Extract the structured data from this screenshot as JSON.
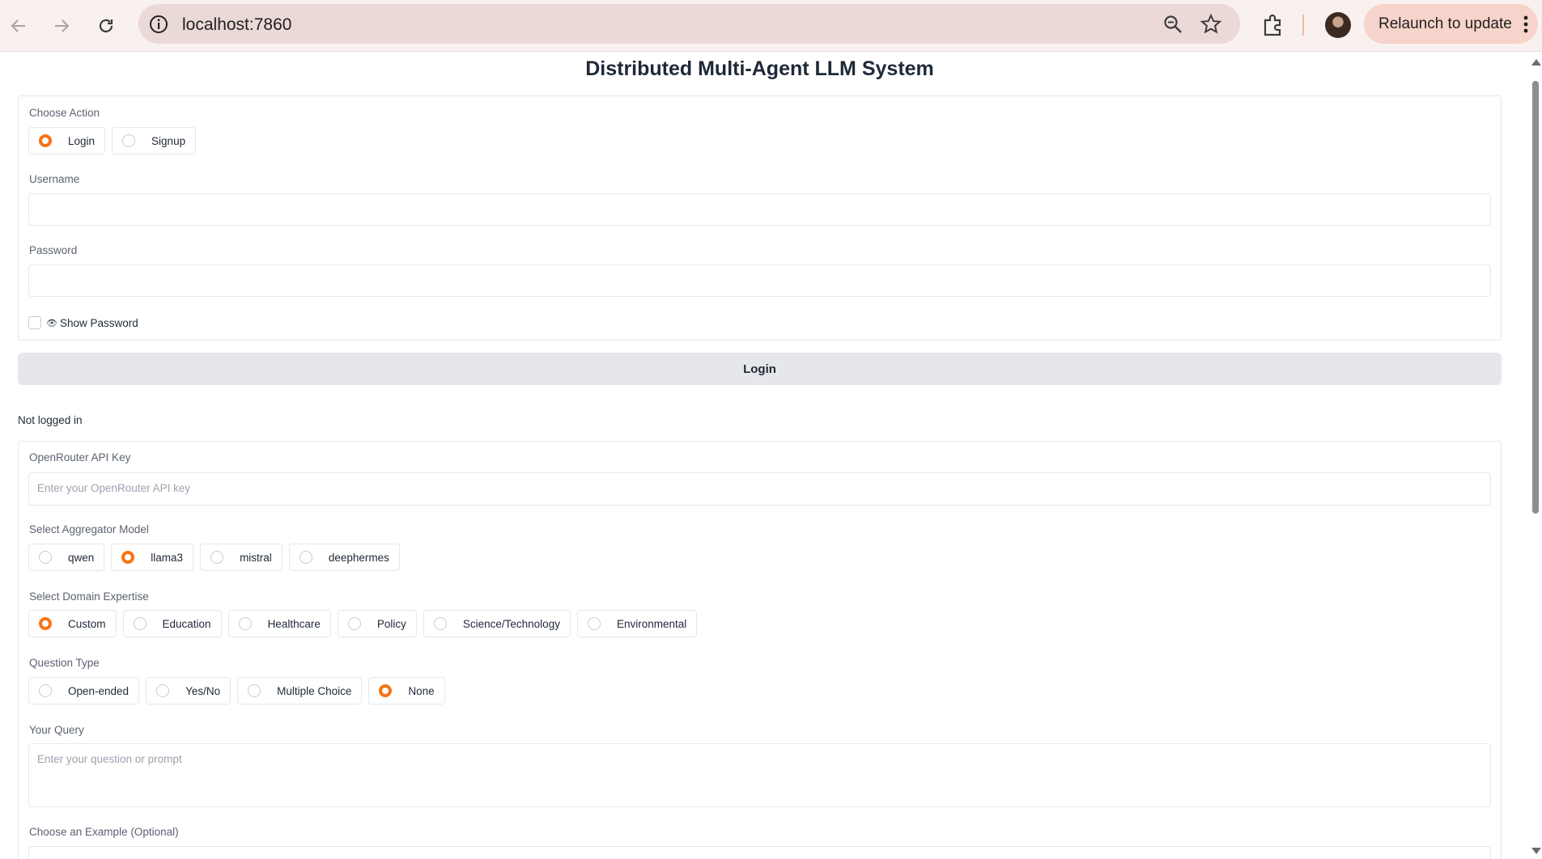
{
  "browser": {
    "url": "localhost:7860",
    "relaunch_label": "Relaunch to update"
  },
  "page_title": "Distributed Multi-Agent LLM System",
  "auth": {
    "choose_action_label": "Choose Action",
    "actions": [
      {
        "label": "Login",
        "selected": true
      },
      {
        "label": "Signup",
        "selected": false
      }
    ],
    "username_label": "Username",
    "username_value": "",
    "password_label": "Password",
    "password_value": "",
    "show_password_label": "Show Password",
    "show_password_checked": false,
    "login_button": "Login",
    "status": "Not logged in"
  },
  "config": {
    "api_key_label": "OpenRouter API Key",
    "api_key_placeholder": "Enter your OpenRouter API key",
    "aggregator_label": "Select Aggregator Model",
    "aggregator_options": [
      {
        "label": "qwen",
        "selected": false
      },
      {
        "label": "llama3",
        "selected": true
      },
      {
        "label": "mistral",
        "selected": false
      },
      {
        "label": "deephermes",
        "selected": false
      }
    ],
    "domain_label": "Select Domain Expertise",
    "domain_options": [
      {
        "label": "Custom",
        "selected": true
      },
      {
        "label": "Education",
        "selected": false
      },
      {
        "label": "Healthcare",
        "selected": false
      },
      {
        "label": "Policy",
        "selected": false
      },
      {
        "label": "Science/Technology",
        "selected": false
      },
      {
        "label": "Environmental",
        "selected": false
      }
    ],
    "question_type_label": "Question Type",
    "question_type_options": [
      {
        "label": "Open-ended",
        "selected": false
      },
      {
        "label": "Yes/No",
        "selected": false
      },
      {
        "label": "Multiple Choice",
        "selected": false
      },
      {
        "label": "None",
        "selected": true
      }
    ],
    "query_label": "Your Query",
    "query_placeholder": "Enter your question or prompt",
    "example_label": "Choose an Example (Optional)"
  },
  "colors": {
    "accent": "#f97316",
    "relaunch_bg": "#f7d4cb"
  }
}
